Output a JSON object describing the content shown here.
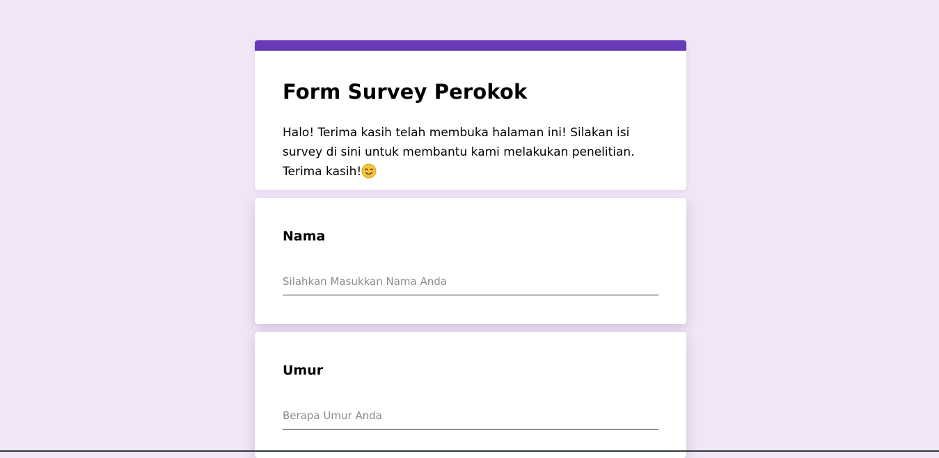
{
  "form": {
    "title": "Form Survey Perokok",
    "description": "Halo! Terima kasih telah membuka halaman ini! Silakan isi survey di sini untuk membantu kami melakukan penelitian. Terima kasih!",
    "accent_color": "#673ab7",
    "background_color": "#f0e6f6",
    "description_icon": "smiling-face-emoji"
  },
  "questions": [
    {
      "label": "Nama",
      "placeholder": "Silahkan Masukkan Nama Anda",
      "value": ""
    },
    {
      "label": "Umur",
      "placeholder": "Berapa Umur Anda",
      "value": ""
    }
  ]
}
